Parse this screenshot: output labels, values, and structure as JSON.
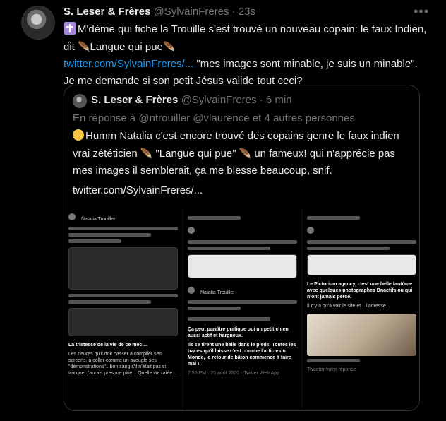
{
  "tweet": {
    "name": "S. Leser & Frères",
    "handle": "@SylvainFreres",
    "time": "23s",
    "text_1": "M'dème qui fiche la Trouille s'est trouvé un nouveau copain: le faux Indien, dit ",
    "text_2": "Langue qui pue",
    "link": "twitter.com/SylvainFreres/...",
    "text_3": " \"mes images sont minable, je suis un minable\". Je me demande si son petit Jésus valide tout ceci?"
  },
  "quote": {
    "name": "S. Leser & Frères",
    "handle": "@SylvainFreres",
    "time": "6 min",
    "reply_prefix": "En réponse à ",
    "reply_to": "@ntrouiller @vlaurence",
    "reply_suffix": " et 4 autres personnes",
    "text_1": "Humm Natalia c'est encore trouvé des copains genre le faux indien vrai zététicien ",
    "text_2": " \"Langue qui pue\" ",
    "text_3": " un fameux! qui n'apprécie pas mes images il semblerait, ça me blesse beaucoup, snif.",
    "link": "twitter.com/SylvainFreres/..."
  },
  "screenshot": {
    "left_title": "Natalia Trouiller",
    "left_caption": "La tristesse de la vie de ce mec ...",
    "left_caption_2": "Les heures qu'il doit passer à compiler ses screens, à coller comme un aveugle ses \"démonstrations\"...bon sang s'il n'était pas si toxique, j'aurais presque pitié... Quelle vie ratée...",
    "mid_title": "Natalia Trouiller",
    "mid_caption": "Ça peut paraître pratique oui un petit chien aussi actif et hargneux.",
    "mid_caption_2": "Ils se tirent une balle dans le pieds. Toutes les traces qu'il laisse c'est comme l'article du Monde, le retour de bâton commence à faire mal !!",
    "mid_footer": "7:55 PM · 23 août 2020 · Twitter Web App",
    "right_caption": "Le Pictorium agency, c'est une belle fantôme avec quelques photographes Bnactifs ou qui n'ont jamais percé.",
    "right_caption_2": "Il n'y a qu'à voir le site et ...l'adresse...",
    "right_footer": "Tweeter votre réponse"
  },
  "colors": {
    "link": "#1d9bf0",
    "muted": "#71767b",
    "border": "#2f3336"
  },
  "icons": [
    "latin-cross-icon",
    "feather-icon",
    "hugging-face-icon",
    "more-icon"
  ]
}
